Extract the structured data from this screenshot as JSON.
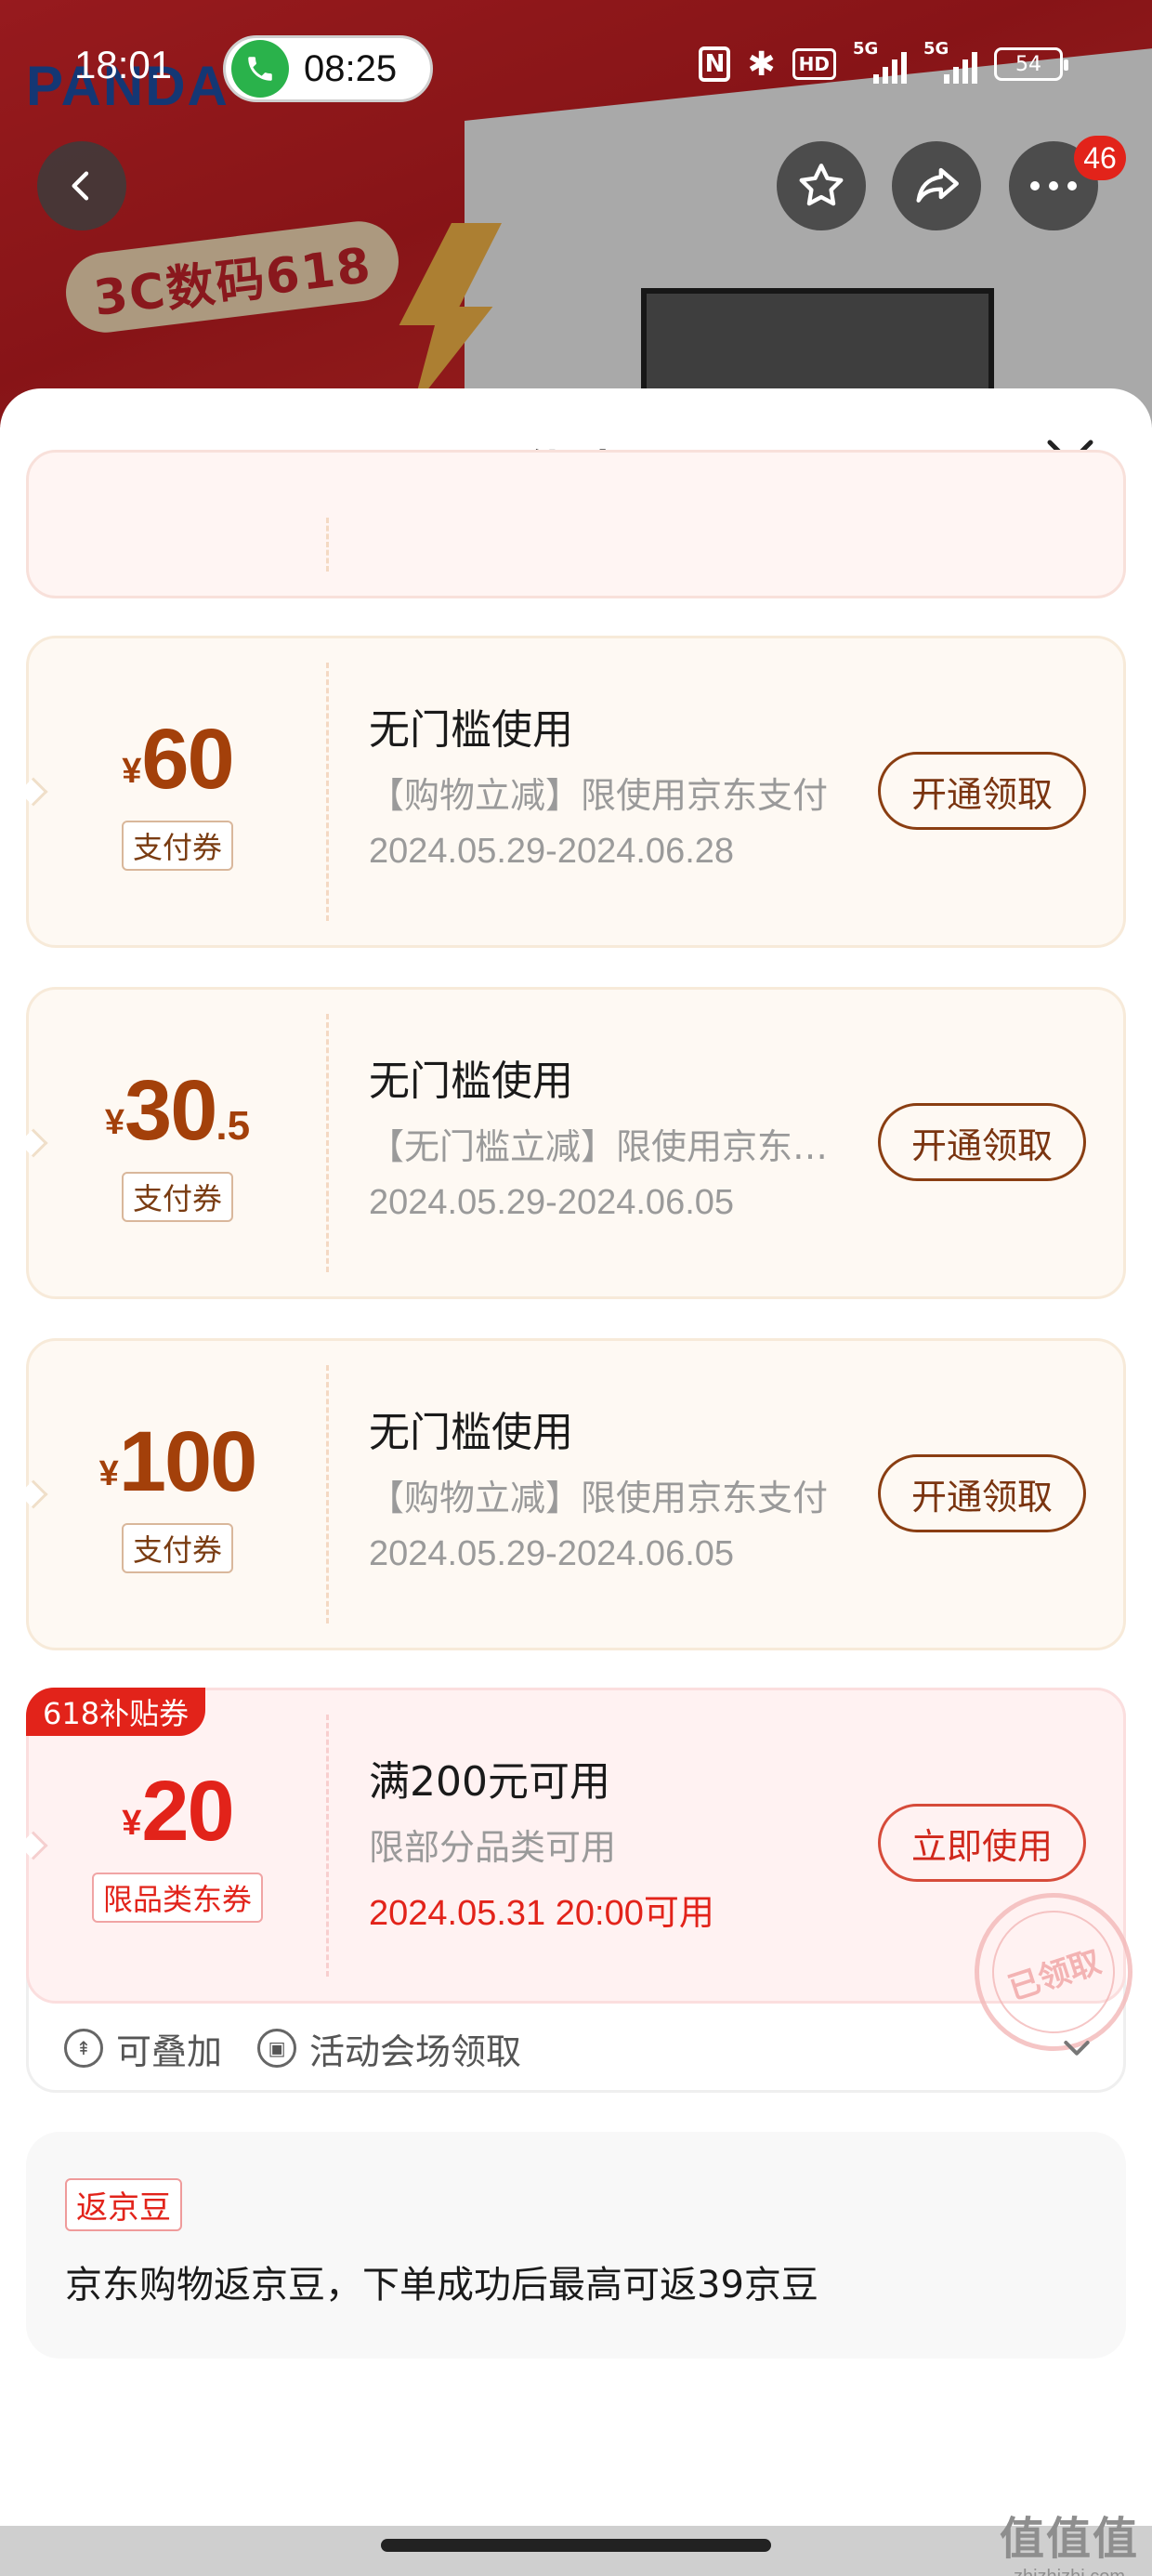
{
  "status_bar": {
    "time": "18:01",
    "call_timer": "08:25",
    "battery": "54",
    "network_1": "5G",
    "network_2": "5G",
    "hd_label": "HD"
  },
  "background": {
    "brand": "PANDA",
    "promo": "3C数码618",
    "more_badge": "46"
  },
  "sheet": {
    "title": "优惠"
  },
  "coupons": [
    {
      "currency": "¥",
      "amount": "60",
      "amount_decimal": "",
      "tag": "支付券",
      "title": "无门槛使用",
      "desc": "【购物立减】限使用京东支付",
      "date": "2024.05.29-2024.06.28",
      "button": "开通领取"
    },
    {
      "currency": "¥",
      "amount": "30",
      "amount_decimal": ".5",
      "tag": "支付券",
      "title": "无门槛使用",
      "desc": "【无门槛立减】限使用京东支付",
      "date": "2024.05.29-2024.06.05",
      "button": "开通领取"
    },
    {
      "currency": "¥",
      "amount": "100",
      "amount_decimal": "",
      "tag": "支付券",
      "title": "无门槛使用",
      "desc": "【购物立减】限使用京东支付",
      "date": "2024.05.29-2024.06.05",
      "button": "开通领取"
    }
  ],
  "coupon_618": {
    "ribbon": "618补贴券",
    "currency": "¥",
    "amount": "20",
    "tag": "限品类东券",
    "title": "满200元可用",
    "desc": "限部分品类可用",
    "date": "2024.05.31 20:00可用",
    "button": "立即使用",
    "stamp": "已领取",
    "features": [
      "可叠加",
      "活动会场领取"
    ]
  },
  "beans": {
    "tag": "返京豆",
    "text": "京东购物返京豆，下单成功后最高可返39京豆"
  },
  "watermark": {
    "big": "值值值",
    "small": "zhizhizhi.com"
  },
  "colors": {
    "brand_red": "#e2231a",
    "coupon_brown": "#a3400a",
    "cream_bg": "#fef9f3",
    "pink_bg": "#fff2f2"
  }
}
